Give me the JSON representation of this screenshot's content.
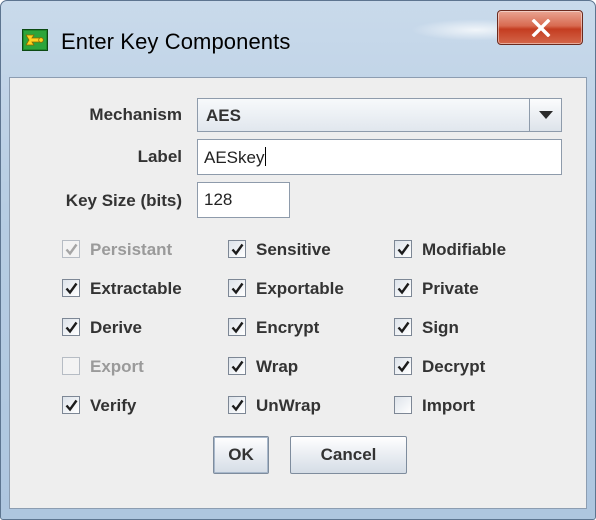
{
  "window": {
    "title": "Enter Key Components",
    "icon": "key-wizard-icon",
    "close_icon": "close-x-icon"
  },
  "form": {
    "mechanism": {
      "label": "Mechanism",
      "value": "AES"
    },
    "key_label": {
      "label": "Label",
      "value": "AESkey"
    },
    "key_size": {
      "label": "Key Size (bits)",
      "value": "128"
    }
  },
  "attributes": [
    {
      "label": "Persistant",
      "checked": true,
      "enabled": false
    },
    {
      "label": "Sensitive",
      "checked": true,
      "enabled": true
    },
    {
      "label": "Modifiable",
      "checked": true,
      "enabled": true
    },
    {
      "label": "Extractable",
      "checked": true,
      "enabled": true
    },
    {
      "label": "Exportable",
      "checked": true,
      "enabled": true
    },
    {
      "label": "Private",
      "checked": true,
      "enabled": true
    },
    {
      "label": "Derive",
      "checked": true,
      "enabled": true
    },
    {
      "label": "Encrypt",
      "checked": true,
      "enabled": true
    },
    {
      "label": "Sign",
      "checked": true,
      "enabled": true
    },
    {
      "label": "Export",
      "checked": false,
      "enabled": false
    },
    {
      "label": "Wrap",
      "checked": true,
      "enabled": true
    },
    {
      "label": "Decrypt",
      "checked": true,
      "enabled": true
    },
    {
      "label": "Verify",
      "checked": true,
      "enabled": true
    },
    {
      "label": "UnWrap",
      "checked": true,
      "enabled": true
    },
    {
      "label": "Import",
      "checked": false,
      "enabled": true
    }
  ],
  "buttons": {
    "ok": "OK",
    "cancel": "Cancel"
  },
  "colors": {
    "title_bar": "#b7cde3",
    "close_button": "#c43d21",
    "panel_background": "#eeeeee",
    "label_text": "#333333",
    "disabled_text": "#9a9a9a"
  }
}
